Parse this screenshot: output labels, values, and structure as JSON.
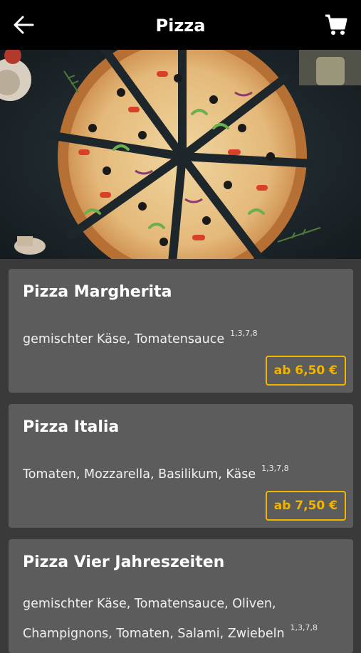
{
  "header": {
    "title": "Pizza",
    "back_icon": "arrow-left-icon",
    "cart_icon": "shopping-cart-icon"
  },
  "hero": {
    "image": "pizza-photo"
  },
  "colors": {
    "header_bg": "#000000",
    "page_bg": "#3a3a3a",
    "card_bg": "#5c5c5c",
    "accent": "#f2b400"
  },
  "products": [
    {
      "name": "Pizza Margherita",
      "description": "gemischter Käse, Tomatensauce",
      "allergens": "1,3,7,8",
      "price": "ab 6,50 €"
    },
    {
      "name": "Pizza Italia",
      "description": "Tomaten, Mozzarella, Basilikum, Käse",
      "allergens": "1,3,7,8",
      "price": "ab 7,50 €"
    },
    {
      "name": "Pizza Vier Jahreszeiten",
      "description": "gemischter Käse, Tomatensauce, Oliven, Champignons, Tomaten, Salami, Zwiebeln",
      "allergens": "1,3,7,8",
      "price": ""
    }
  ]
}
